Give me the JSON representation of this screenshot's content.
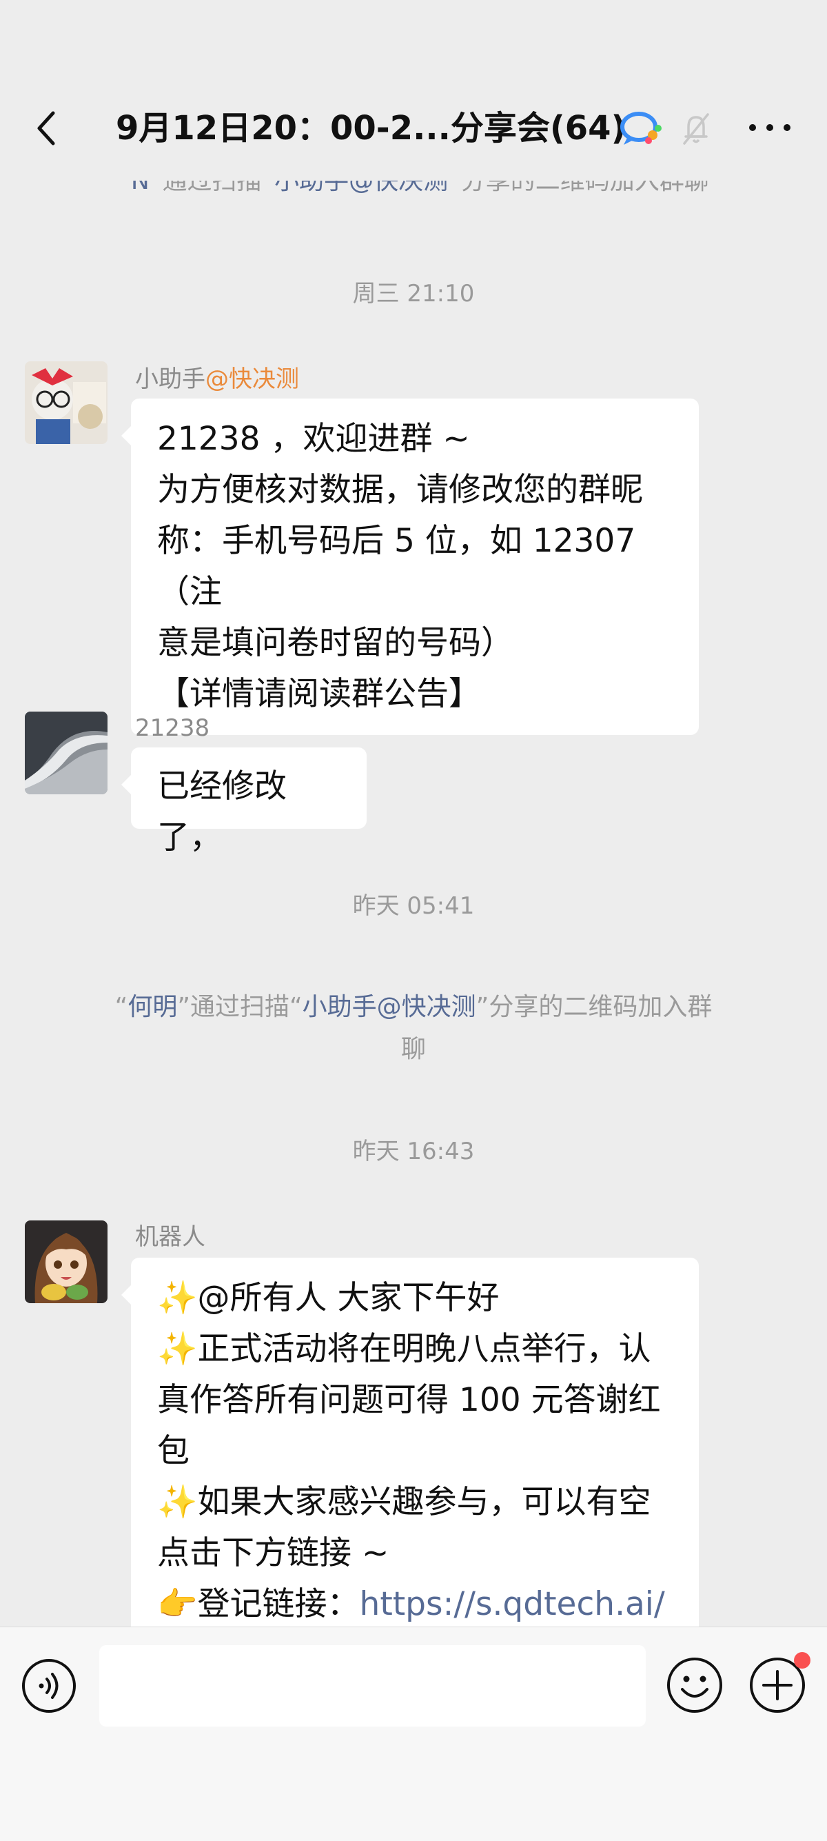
{
  "header": {
    "title": "9月12日20：00-2...分享会(64)"
  },
  "messages": {
    "sys1": {
      "q1": "“",
      "name": "N",
      "mid1": "”通过扫描“",
      "inviter": "小助手@快决测",
      "tail": "”分享的二维码加入群聊"
    },
    "ts1": "周三 21:10",
    "msg1": {
      "sender_plain": "小助手",
      "sender_highlight": "@快决测",
      "lines": [
        "21238 ，欢迎进群 ~",
        "为方便核对数据，请修改您的群昵",
        "称：手机号码后 5 位，如 12307（注",
        "意是填问卷时留的号码）",
        "【详情请阅读群公告】"
      ]
    },
    "msg2": {
      "sender": "21238",
      "text": "已经修改了，"
    },
    "ts2": "昨天 05:41",
    "sys2": {
      "q1": "“",
      "name": "何明",
      "mid1": "”通过扫描“",
      "inviter": "小助手@快决测",
      "tail1": "”分享的二维码加入群",
      "tail2": "聊"
    },
    "ts3": "昨天 16:43",
    "msg3": {
      "sender": "机器人",
      "lines": [
        "✨@所有人  大家下午好",
        "✨正式活动将在明晚八点举行，认",
        "真作答所有问题可得 100 元答谢红",
        "包",
        "✨如果大家感兴趣参与，可以有空",
        "点击下方链接 ~"
      ],
      "link_prefix": "👉登记链接：",
      "link_text": "https://s.qdtech.ai/"
    }
  },
  "input": {
    "placeholder": ""
  },
  "colors": {
    "background": "#ededed",
    "link": "#576b95",
    "highlight_orange": "#ea8a3b",
    "notification_dot": "#fa5151"
  }
}
